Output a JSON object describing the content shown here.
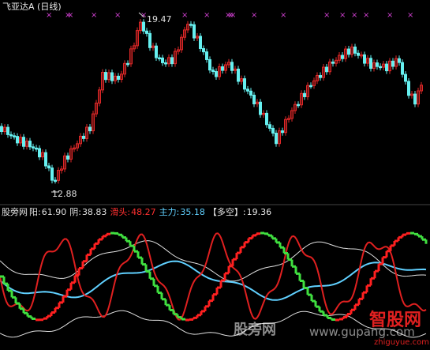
{
  "top_chart": {
    "title": "飞亚达A (日线)",
    "high_label": "19.47",
    "low_label": "12.88",
    "marker_glyph": "×",
    "colors": {
      "up": "#e02828",
      "down": "#66f0f0",
      "marker": "#d040d0",
      "arrow": "#e0e0e0"
    }
  },
  "indicator": {
    "site": "股旁网",
    "yang_label": "阳:",
    "yang_value": "61.90",
    "yin_label": "阴:",
    "yin_value": "38.83",
    "hua_label": "滑头:",
    "hua_value": "48.27",
    "zhu_label": "主力:",
    "zhu_value": "35.18",
    "duo_label": "【多空】:",
    "duo_value": "19.36",
    "colors": {
      "yang": "#e02020",
      "yin": "#e0e0e0",
      "zhu": "#60d0ff",
      "duo": "#e8e8e8",
      "bar_up": "#ff2020",
      "bar_dn": "#40e040"
    }
  },
  "watermark": {
    "cn": "股旁网",
    "url": "www.gupang.com",
    "logo": "智股网",
    "logo_url": "zhiguyue.com"
  },
  "chart_data": {
    "type": "line",
    "title": "飞亚达A (日线)",
    "y_range": [
      12.88,
      19.47
    ],
    "annotations": [
      "19.47",
      "12.88"
    ],
    "series": [
      {
        "name": "阳",
        "values": [
          61.9
        ]
      },
      {
        "name": "阴",
        "values": [
          38.83
        ]
      },
      {
        "name": "滑头",
        "values": [
          48.27
        ]
      },
      {
        "name": "主力",
        "values": [
          35.18
        ]
      },
      {
        "name": "多空",
        "values": [
          19.36
        ]
      }
    ]
  }
}
